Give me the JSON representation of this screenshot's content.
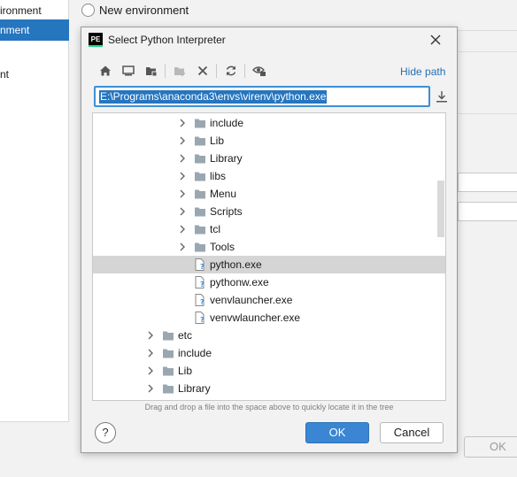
{
  "background": {
    "sidebar": {
      "items": [
        {
          "label": "ironment"
        },
        {
          "label": "nment"
        },
        {
          "label": "nt"
        }
      ]
    },
    "new_environment_label": "New environment",
    "ok_label": "OK"
  },
  "dialog": {
    "title": "Select Python Interpreter",
    "app_logo_text": "PE",
    "hide_path_label": "Hide path",
    "path_value": "E:\\Programs\\anaconda3\\envs\\virenv\\python.exe",
    "toolbar": [
      "home-icon",
      "desktop-icon",
      "project-folder-icon",
      "new-folder-icon",
      "delete-icon",
      "refresh-icon",
      "show-hidden-icon"
    ],
    "tree": [
      {
        "label": "include",
        "type": "folder",
        "depth": 2
      },
      {
        "label": "Lib",
        "type": "folder",
        "depth": 2
      },
      {
        "label": "Library",
        "type": "folder",
        "depth": 2
      },
      {
        "label": "libs",
        "type": "folder",
        "depth": 2
      },
      {
        "label": "Menu",
        "type": "folder",
        "depth": 2
      },
      {
        "label": "Scripts",
        "type": "folder",
        "depth": 2
      },
      {
        "label": "tcl",
        "type": "folder",
        "depth": 2
      },
      {
        "label": "Tools",
        "type": "folder",
        "depth": 2
      },
      {
        "label": "python.exe",
        "type": "file",
        "depth": 2,
        "selected": true
      },
      {
        "label": "pythonw.exe",
        "type": "file",
        "depth": 2
      },
      {
        "label": "venvlauncher.exe",
        "type": "file",
        "depth": 2
      },
      {
        "label": "venvwlauncher.exe",
        "type": "file",
        "depth": 2
      },
      {
        "label": "etc",
        "type": "folder",
        "depth": 1
      },
      {
        "label": "include",
        "type": "folder",
        "depth": 1
      },
      {
        "label": "Lib",
        "type": "folder",
        "depth": 1
      },
      {
        "label": "Library",
        "type": "folder",
        "depth": 1
      }
    ],
    "hint": "Drag and drop a file into the space above to quickly locate it in the tree",
    "help_label": "?",
    "ok_label": "OK",
    "cancel_label": "Cancel",
    "colors": {
      "accent": "#2675bf",
      "link": "#2470b3",
      "selection": "#d5d5d5",
      "folder": "#9aa7b0"
    }
  }
}
